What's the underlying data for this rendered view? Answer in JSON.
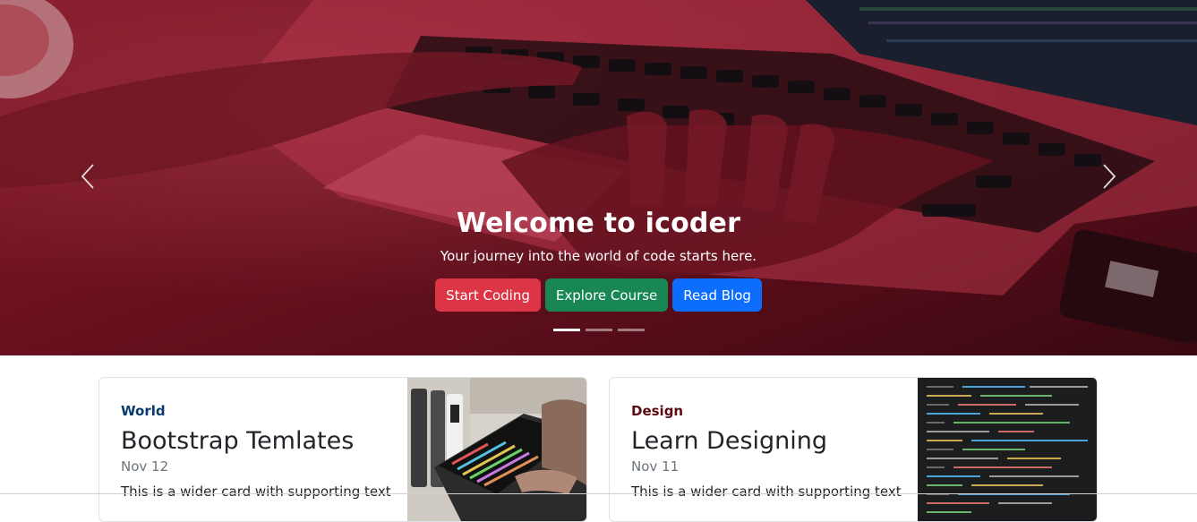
{
  "hero": {
    "title": "Welcome to icoder",
    "subtitle": "Your journey into the world of code starts here.",
    "buttons": [
      {
        "label": "Start Coding",
        "color": "#dc3545"
      },
      {
        "label": "Explore Course",
        "color": "#198754"
      },
      {
        "label": "Read Blog",
        "color": "#0d6efd"
      }
    ],
    "indicators": {
      "count": 3,
      "active": 0
    },
    "controls": {
      "prev_icon": "chevron-left-icon",
      "next_icon": "chevron-right-icon"
    }
  },
  "cards": [
    {
      "category": "World",
      "category_color": "#0a3a6e",
      "title": "Bootstrap Temlates",
      "date": "Nov 12",
      "text": "This is a wider card with supporting text"
    },
    {
      "category": "Design",
      "category_color": "#5c0a12",
      "title": "Learn Designing",
      "date": "Nov 11",
      "text": "This is a wider card with supporting text"
    }
  ]
}
